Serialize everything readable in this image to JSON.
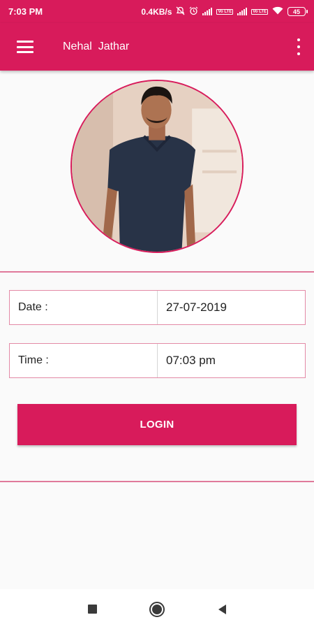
{
  "status_bar": {
    "time": "7:03 PM",
    "network_speed": "0.4KB/s",
    "volte_1": "Vo LTE",
    "volte_2": "Vo LTE",
    "battery": "45",
    "icons": [
      "mute-icon",
      "alarm-icon",
      "signal-icon",
      "signal-icon",
      "wifi-icon",
      "battery-icon"
    ]
  },
  "app_bar": {
    "title": "Nehal  Jathar",
    "menu_icon": "hamburger-menu-icon",
    "overflow_icon": "more-vert-icon"
  },
  "form": {
    "date": {
      "label": "Date :",
      "value": "27-07-2019"
    },
    "time": {
      "label": "Time :",
      "value": "07:03 pm"
    }
  },
  "login_button": {
    "label": "LOGIN"
  },
  "nav_bar": {
    "icons": [
      "recents-icon",
      "home-icon",
      "back-icon"
    ]
  },
  "colors": {
    "primary": "#d81b5b",
    "field_border": "#e38aa6",
    "background": "#fafafa"
  }
}
